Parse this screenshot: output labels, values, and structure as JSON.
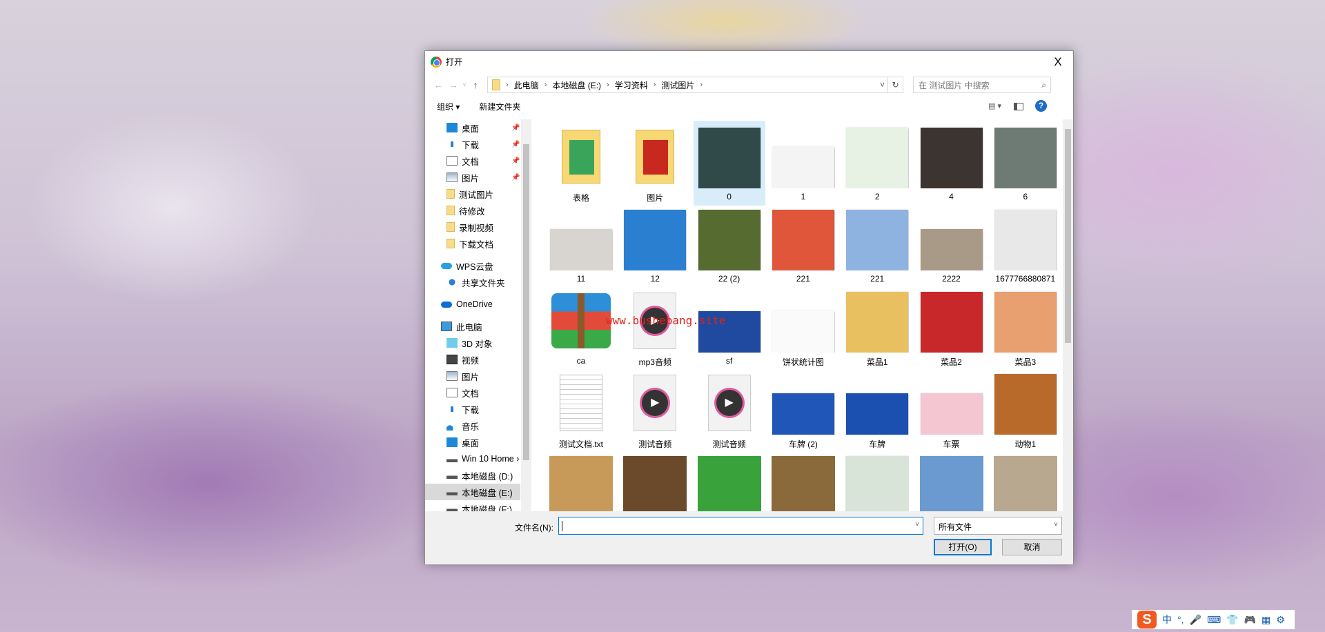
{
  "window": {
    "title": "打开",
    "close": "X"
  },
  "address": {
    "crumbs": [
      "此电脑",
      "本地磁盘 (E:)",
      "学习资料",
      "测试图片"
    ],
    "search_placeholder": "在 测试图片 中搜索"
  },
  "toolbar": {
    "organize": "组织 ▾",
    "new_folder": "新建文件夹",
    "help": "?"
  },
  "sidebar": [
    {
      "label": "桌面",
      "icon": "desktop",
      "pinned": true,
      "indent": 2
    },
    {
      "label": "下载",
      "icon": "download",
      "pinned": true,
      "indent": 2
    },
    {
      "label": "文档",
      "icon": "document",
      "pinned": true,
      "indent": 2
    },
    {
      "label": "图片",
      "icon": "picture",
      "pinned": true,
      "indent": 2
    },
    {
      "label": "测试图片",
      "icon": "folder",
      "indent": 2
    },
    {
      "label": "待修改",
      "icon": "folder",
      "indent": 2
    },
    {
      "label": "录制视频",
      "icon": "folder",
      "indent": 2
    },
    {
      "label": "下载文档",
      "icon": "folder",
      "indent": 2
    },
    {
      "label": "WPS云盘",
      "icon": "cloud",
      "indent": 1,
      "gap": true
    },
    {
      "label": "共享文件夹",
      "icon": "share",
      "indent": 2
    },
    {
      "label": "OneDrive",
      "icon": "onedrive",
      "indent": 1,
      "gap": true
    },
    {
      "label": "此电脑",
      "icon": "pc",
      "indent": 1,
      "gap": true
    },
    {
      "label": "3D 对象",
      "icon": "3d",
      "indent": 2
    },
    {
      "label": "视频",
      "icon": "video",
      "indent": 2
    },
    {
      "label": "图片",
      "icon": "picture",
      "indent": 2
    },
    {
      "label": "文档",
      "icon": "document",
      "indent": 2
    },
    {
      "label": "下载",
      "icon": "download",
      "indent": 2
    },
    {
      "label": "音乐",
      "icon": "music",
      "indent": 2
    },
    {
      "label": "桌面",
      "icon": "desktop",
      "indent": 2
    },
    {
      "label": "Win 10 Home ›",
      "icon": "drive",
      "indent": 2
    },
    {
      "label": "本地磁盘 (D:)",
      "icon": "drive",
      "indent": 2
    },
    {
      "label": "本地磁盘 (E:)",
      "icon": "drive",
      "indent": 2,
      "selected": true
    },
    {
      "label": "本地磁盘 (F:)",
      "icon": "drive",
      "indent": 2
    }
  ],
  "files": [
    {
      "name": "表格",
      "type": "folder",
      "color": "#3aa55a"
    },
    {
      "name": "图片",
      "type": "folder",
      "color": "#c8281e"
    },
    {
      "name": "0",
      "type": "image",
      "color": "#2f4a48",
      "selected": true
    },
    {
      "name": "1",
      "type": "image",
      "color": "#f4f4f4"
    },
    {
      "name": "2",
      "type": "image",
      "color": "#e7f1e4"
    },
    {
      "name": "4",
      "type": "image",
      "color": "#3b3430"
    },
    {
      "name": "6",
      "type": "image",
      "color": "#6d7b74"
    },
    {
      "name": "11",
      "type": "image",
      "color": "#d8d5d0"
    },
    {
      "name": "12",
      "type": "image",
      "color": "#2a7fd0"
    },
    {
      "name": "22 (2)",
      "type": "image",
      "color": "#556b2f"
    },
    {
      "name": "221",
      "type": "image",
      "color": "#e0563a"
    },
    {
      "name": "221",
      "type": "image",
      "color": "#8fb3e0"
    },
    {
      "name": "2222",
      "type": "image",
      "color": "#a89a86"
    },
    {
      "name": "1677766880871",
      "type": "image",
      "color": "#e8e8e8"
    },
    {
      "name": "ca",
      "type": "archive",
      "color": "#2c8fd8"
    },
    {
      "name": "mp3音频",
      "type": "audio",
      "color": "#f2f2f2"
    },
    {
      "name": "sf",
      "type": "image",
      "color": "#1f4aa0"
    },
    {
      "name": "饼状统计图",
      "type": "image",
      "color": "#fafafa"
    },
    {
      "name": "菜品1",
      "type": "image",
      "color": "#e8c060"
    },
    {
      "name": "菜品2",
      "type": "image",
      "color": "#c8282a"
    },
    {
      "name": "菜品3",
      "type": "image",
      "color": "#e8a070"
    },
    {
      "name": "测试文档.txt",
      "type": "text",
      "color": "#ffffff"
    },
    {
      "name": "测试音频",
      "type": "audio",
      "color": "#f2f2f2"
    },
    {
      "name": "测试音频",
      "type": "audio",
      "color": "#f2f2f2"
    },
    {
      "name": "车牌 (2)",
      "type": "image",
      "color": "#1f56b8"
    },
    {
      "name": "车牌",
      "type": "image",
      "color": "#1b4fb0"
    },
    {
      "name": "车票",
      "type": "image",
      "color": "#f3c6d2"
    },
    {
      "name": "动物1",
      "type": "image",
      "color": "#b86a2a"
    },
    {
      "name": "",
      "type": "image",
      "color": "#c89a5a"
    },
    {
      "name": "",
      "type": "image",
      "color": "#6a4a2a"
    },
    {
      "name": "",
      "type": "image",
      "color": "#3aa23a"
    },
    {
      "name": "",
      "type": "image",
      "color": "#8a6a3a"
    },
    {
      "name": "",
      "type": "image",
      "color": "#d8e4d8"
    },
    {
      "name": "",
      "type": "image",
      "color": "#6a9ad0"
    },
    {
      "name": "",
      "type": "image",
      "color": "#b8a890"
    }
  ],
  "footer": {
    "filename_label": "文件名(N):",
    "filename_value": "",
    "filter": "所有文件",
    "open": "打开(O)",
    "cancel": "取消"
  },
  "watermark": "www.bushebang.site",
  "tray": {
    "ime": "S",
    "items": [
      "中",
      "°,",
      "🎤",
      "⌨",
      "👕",
      "🎮",
      "▦",
      "⚙"
    ]
  }
}
